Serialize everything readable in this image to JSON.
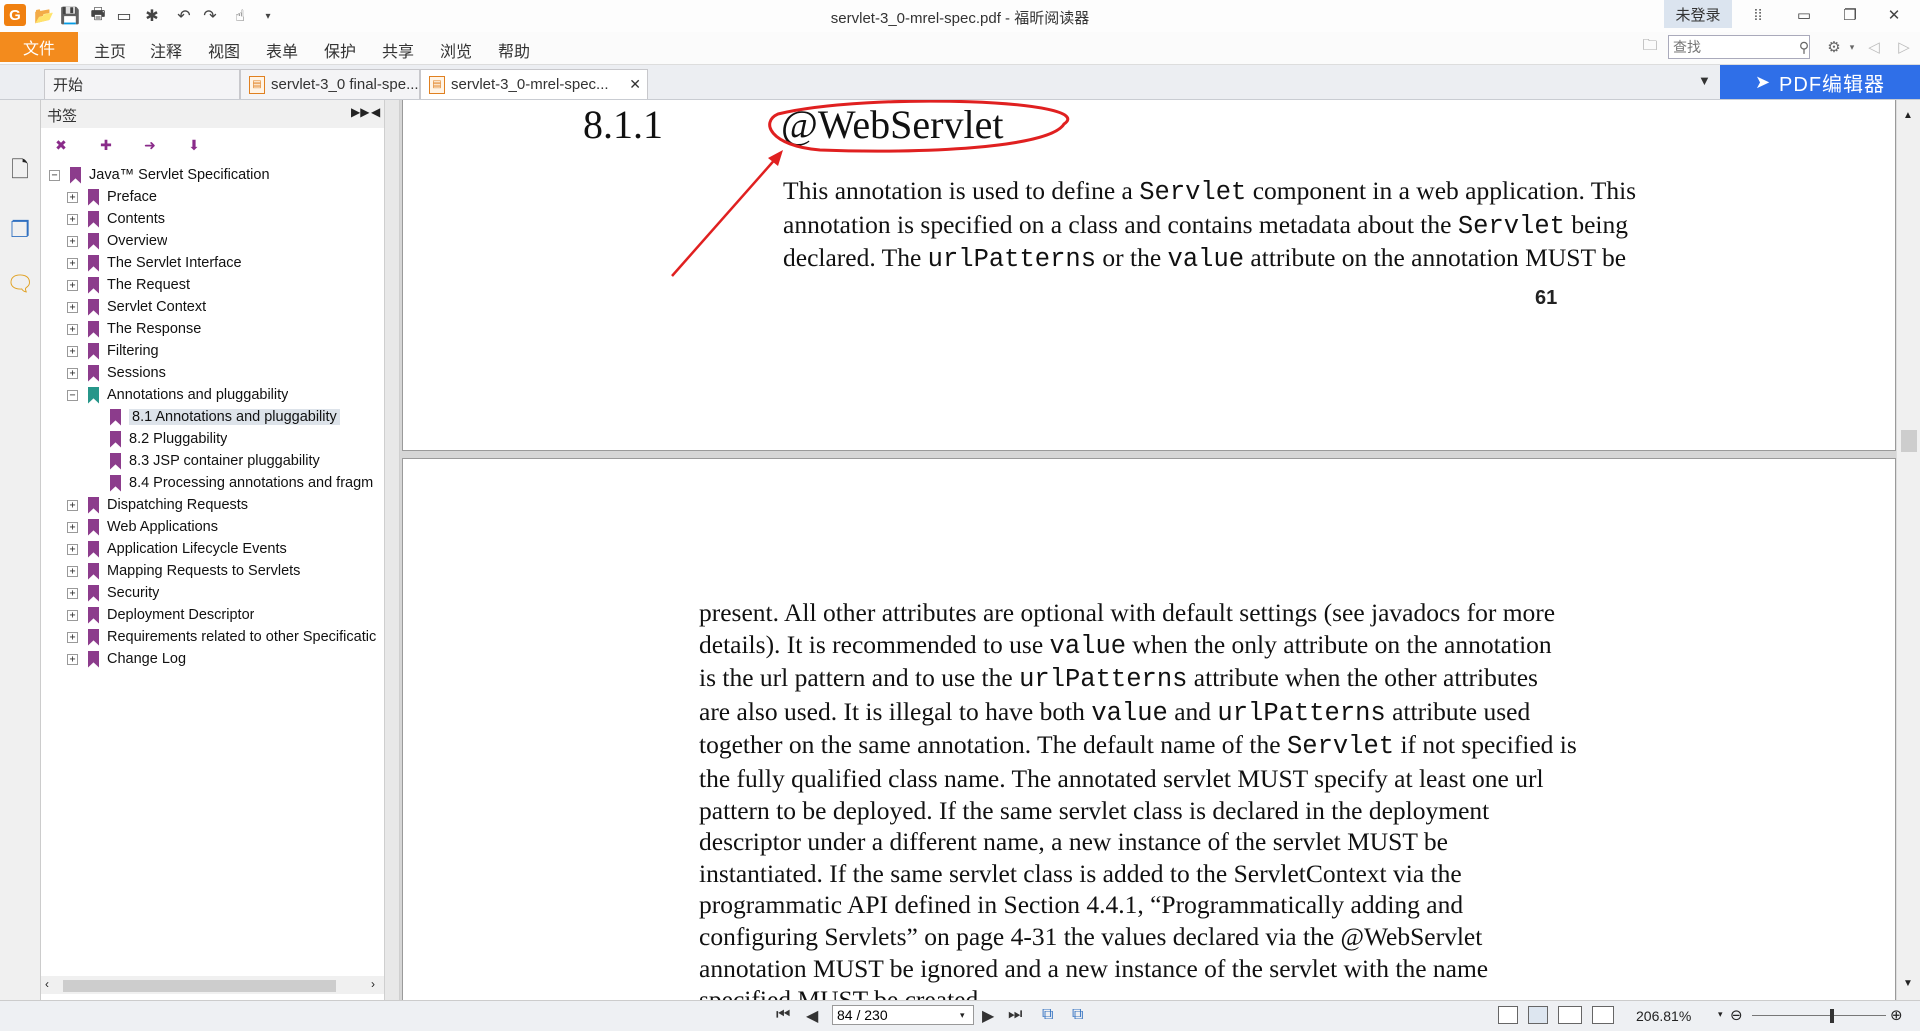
{
  "window": {
    "title": "servlet-3_0-mrel-spec.pdf - 福昕阅读器",
    "login_label": "未登录",
    "app_icon_letter": "G"
  },
  "menu": {
    "file": "文件",
    "items": [
      "主页",
      "注释",
      "视图",
      "表单",
      "保护",
      "共享",
      "浏览",
      "帮助"
    ],
    "search_placeholder": "查找"
  },
  "tabs": [
    {
      "label": "开始"
    },
    {
      "label": "servlet-3_0 final-spe..."
    },
    {
      "label": "servlet-3_0-mrel-spec..."
    }
  ],
  "pdf_editor_label": "PDF编辑器",
  "bookmarks": {
    "title": "书签",
    "items": [
      {
        "label": "Java™ Servlet Specification",
        "level": 0,
        "expander": "−"
      },
      {
        "label": "Preface",
        "level": 1,
        "expander": "+"
      },
      {
        "label": "Contents",
        "level": 1,
        "expander": "+"
      },
      {
        "label": "Overview",
        "level": 1,
        "expander": "+"
      },
      {
        "label": "The Servlet Interface",
        "level": 1,
        "expander": "+"
      },
      {
        "label": "The Request",
        "level": 1,
        "expander": "+"
      },
      {
        "label": "Servlet Context",
        "level": 1,
        "expander": "+"
      },
      {
        "label": "The Response",
        "level": 1,
        "expander": "+"
      },
      {
        "label": "Filtering",
        "level": 1,
        "expander": "+"
      },
      {
        "label": "Sessions",
        "level": 1,
        "expander": "+"
      },
      {
        "label": "Annotations and pluggability",
        "level": 1,
        "expander": "−",
        "teal": true
      },
      {
        "label": "8.1 Annotations and pluggability",
        "level": 2,
        "selected": true
      },
      {
        "label": "8.2 Pluggability",
        "level": 2
      },
      {
        "label": "8.3 JSP container pluggability",
        "level": 2
      },
      {
        "label": "8.4 Processing annotations and fragm",
        "level": 2
      },
      {
        "label": "Dispatching Requests",
        "level": 1,
        "expander": "+"
      },
      {
        "label": "Web Applications",
        "level": 1,
        "expander": "+"
      },
      {
        "label": "Application Lifecycle Events",
        "level": 1,
        "expander": "+"
      },
      {
        "label": "Mapping Requests to Servlets",
        "level": 1,
        "expander": "+"
      },
      {
        "label": "Security",
        "level": 1,
        "expander": "+"
      },
      {
        "label": "Deployment Descriptor",
        "level": 1,
        "expander": "+"
      },
      {
        "label": "Requirements related to other Specificatic",
        "level": 1,
        "expander": "+"
      },
      {
        "label": "Change Log",
        "level": 1,
        "expander": "+"
      }
    ]
  },
  "document": {
    "page1": {
      "section_number": "8.1.1",
      "section_title": "@WebServlet",
      "lines": [
        [
          "This annotation is used to define a ",
          {
            "code": "Servlet"
          },
          " component in a web application. This"
        ],
        [
          "annotation is specified on a class and contains metadata about the ",
          {
            "code": "Servlet"
          },
          " being"
        ],
        [
          "declared. The ",
          {
            "code": "urlPatterns"
          },
          " or the ",
          {
            "code": "value"
          },
          " attribute on the annotation MUST be"
        ]
      ],
      "page_number": "61"
    },
    "page2": {
      "lines": [
        [
          "present. All other attributes are optional with default settings (see javadocs for more"
        ],
        [
          "details). It is recommended to use ",
          {
            "code": "value"
          },
          " when the only attribute on the annotation"
        ],
        [
          "is the url pattern and to use the ",
          {
            "code": "urlPatterns"
          },
          " attribute when the other attributes"
        ],
        [
          "are also used. It is illegal to have both ",
          {
            "code": "value"
          },
          " and ",
          {
            "code": "urlPatterns"
          },
          " attribute used"
        ],
        [
          "together on the same annotation. The default name of the ",
          {
            "code": "Servlet"
          },
          " if not specified is"
        ],
        [
          "the fully qualified class name. The annotated servlet MUST specify at least one url"
        ],
        [
          "pattern to be deployed. If the same servlet class is declared in the deployment"
        ],
        [
          "descriptor under a different name, a new instance of the servlet MUST be"
        ],
        [
          "instantiated. If the same servlet class is added to the ServletContext via the"
        ],
        [
          "programmatic API defined in Section 4.4.1, “Programmatically adding and"
        ],
        [
          "configuring Servlets” on page 4-31 the values declared via the @WebServlet"
        ],
        [
          "annotation MUST be ignored and a new instance of the servlet with the name"
        ],
        [
          "specified MUST be created."
        ]
      ]
    }
  },
  "status": {
    "page_indicator": "84 / 230",
    "zoom": "206.81%"
  },
  "annotation_color": "#e02020"
}
